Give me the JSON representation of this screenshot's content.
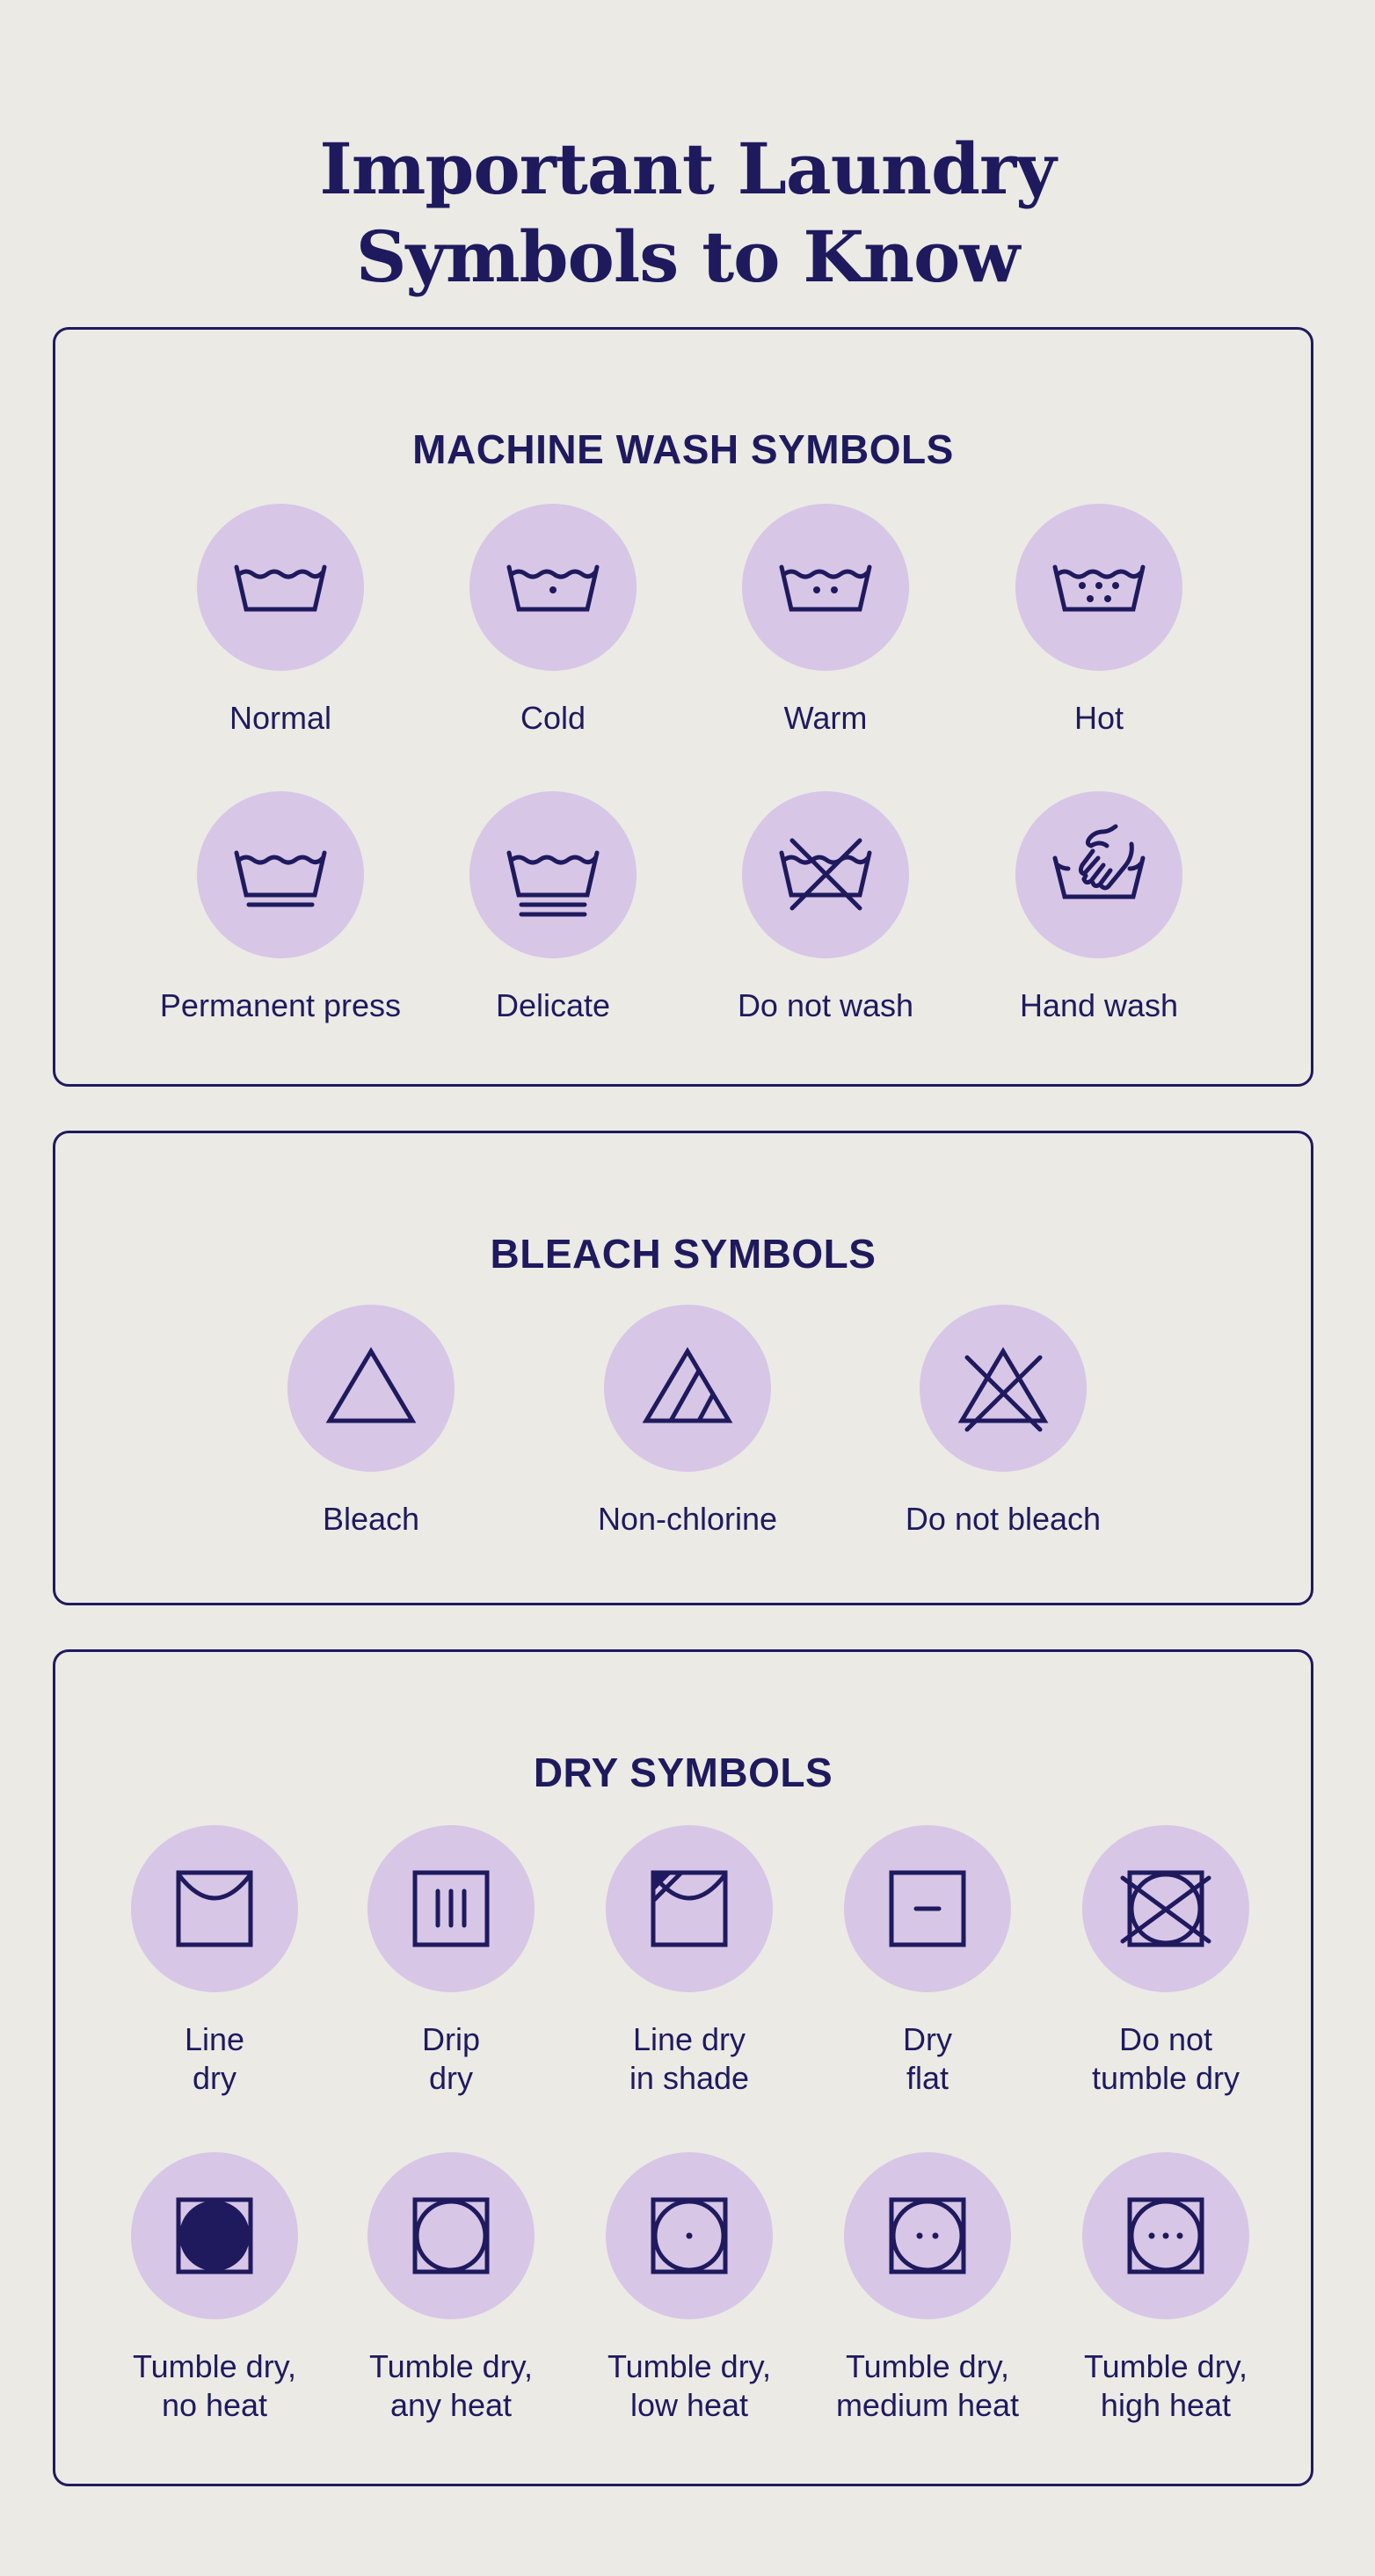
{
  "title": {
    "line1": "Important Laundry",
    "line2": "Symbols to Know"
  },
  "colors": {
    "ink": "#1f1a5e",
    "circle": "#d7c6e6",
    "background": "#ebeae5"
  },
  "sections": [
    {
      "heading": "MACHINE WASH SYMBOLS",
      "items": [
        {
          "icon": "wash-normal-icon",
          "label": [
            "Normal"
          ]
        },
        {
          "icon": "wash-cold-icon",
          "label": [
            "Cold"
          ]
        },
        {
          "icon": "wash-warm-icon",
          "label": [
            "Warm"
          ]
        },
        {
          "icon": "wash-hot-icon",
          "label": [
            "Hot"
          ]
        },
        {
          "icon": "wash-permanent-press-icon",
          "label": [
            "Permanent press"
          ]
        },
        {
          "icon": "wash-delicate-icon",
          "label": [
            "Delicate"
          ]
        },
        {
          "icon": "do-not-wash-icon",
          "label": [
            "Do not wash"
          ]
        },
        {
          "icon": "hand-wash-icon",
          "label": [
            "Hand wash"
          ]
        }
      ]
    },
    {
      "heading": "BLEACH SYMBOLS",
      "items": [
        {
          "icon": "bleach-icon",
          "label": [
            "Bleach"
          ]
        },
        {
          "icon": "non-chlorine-bleach-icon",
          "label": [
            "Non-chlorine"
          ]
        },
        {
          "icon": "do-not-bleach-icon",
          "label": [
            "Do not bleach"
          ]
        }
      ]
    },
    {
      "heading": "DRY SYMBOLS",
      "items": [
        {
          "icon": "line-dry-icon",
          "label": [
            "Line",
            "dry"
          ]
        },
        {
          "icon": "drip-dry-icon",
          "label": [
            "Drip",
            "dry"
          ]
        },
        {
          "icon": "line-dry-shade-icon",
          "label": [
            "Line dry",
            "in shade"
          ]
        },
        {
          "icon": "dry-flat-icon",
          "label": [
            "Dry",
            "flat"
          ]
        },
        {
          "icon": "do-not-tumble-dry-icon",
          "label": [
            "Do not",
            "tumble dry"
          ]
        },
        {
          "icon": "tumble-dry-no-heat-icon",
          "label": [
            "Tumble dry,",
            "no heat"
          ]
        },
        {
          "icon": "tumble-dry-any-heat-icon",
          "label": [
            "Tumble dry,",
            "any heat"
          ]
        },
        {
          "icon": "tumble-dry-low-heat-icon",
          "label": [
            "Tumble dry,",
            "low heat"
          ]
        },
        {
          "icon": "tumble-dry-medium-heat-icon",
          "label": [
            "Tumble dry,",
            "medium heat"
          ]
        },
        {
          "icon": "tumble-dry-high-heat-icon",
          "label": [
            "Tumble dry,",
            "high heat"
          ]
        }
      ]
    }
  ]
}
